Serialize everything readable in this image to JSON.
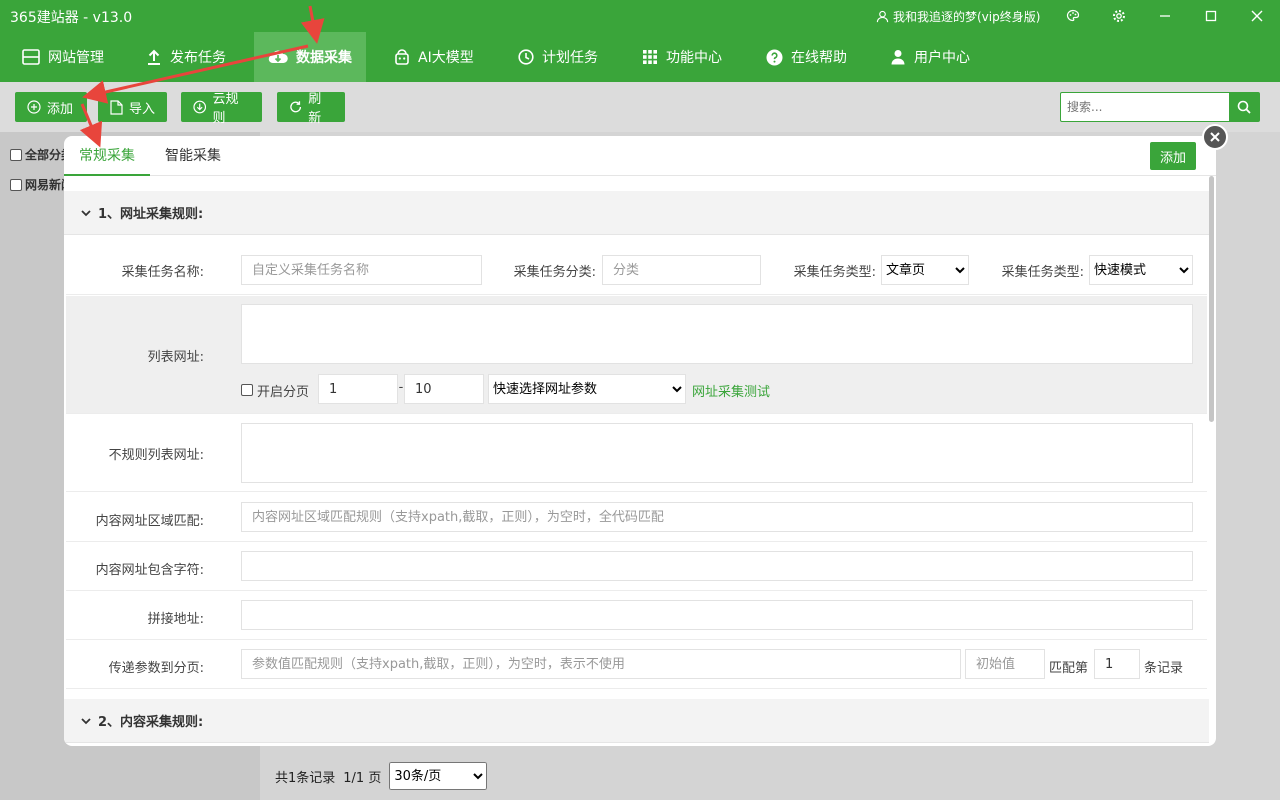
{
  "window": {
    "title": "365建站器 - v13.0",
    "user": "我和我追逐的梦(vip终身版)"
  },
  "nav": {
    "items": [
      {
        "label": "网站管理",
        "icon": "site-icon"
      },
      {
        "label": "发布任务",
        "icon": "upload-icon"
      },
      {
        "label": "数据采集",
        "icon": "cloud-download-icon",
        "active": true
      },
      {
        "label": "AI大模型",
        "icon": "robot-icon"
      },
      {
        "label": "计划任务",
        "icon": "clock-icon"
      },
      {
        "label": "功能中心",
        "icon": "grid-icon"
      },
      {
        "label": "在线帮助",
        "icon": "help-icon"
      },
      {
        "label": "用户中心",
        "icon": "user-icon"
      }
    ]
  },
  "toolbar": {
    "add": "添加",
    "import": "导入",
    "cloud_rules": "云规则",
    "refresh": "刷新",
    "search_placeholder": "搜索..."
  },
  "left_panel": {
    "items": [
      "全部分类",
      "网易新闻"
    ]
  },
  "pager": {
    "total": "共1条记录",
    "pages": "1/1 页",
    "per_page": "30条/页"
  },
  "modal": {
    "tabs": [
      "常规采集",
      "智能采集"
    ],
    "add_button": "添加",
    "section1_title": "1、网址采集规则:",
    "section2_title": "2、内容采集规则:",
    "fields": {
      "task_name_label": "采集任务名称:",
      "task_name_placeholder": "自定义采集任务名称",
      "task_category_label": "采集任务分类:",
      "task_category_placeholder": "分类",
      "task_type_label": "采集任务类型:",
      "task_type_value": "文章页",
      "task_mode_label": "采集任务类型:",
      "task_mode_value": "快速模式",
      "list_url_label": "列表网址:",
      "paging_label": "开启分页",
      "page_from": "1",
      "page_sep": "-",
      "page_to": "10",
      "quick_param": "快速选择网址参数",
      "url_test": "网址采集测试",
      "irregular_label": "不规则列表网址:",
      "content_area_label": "内容网址区域匹配:",
      "content_area_placeholder": "内容网址区域匹配规则（支持xpath,截取，正则），为空时，全代码匹配",
      "content_contains_label": "内容网址包含字符:",
      "join_label": "拼接地址:",
      "pass_param_label": "传递参数到分页:",
      "pass_param_placeholder": "参数值匹配规则（支持xpath,截取，正则），为空时，表示不使用",
      "initial_placeholder": "初始值",
      "match_prefix": "匹配第",
      "match_value": "1",
      "match_suffix": "条记录"
    }
  },
  "colors": {
    "brand_green": "#3aa53a",
    "nav_active": "#5cb85c",
    "arrow_red": "#e8453c"
  }
}
